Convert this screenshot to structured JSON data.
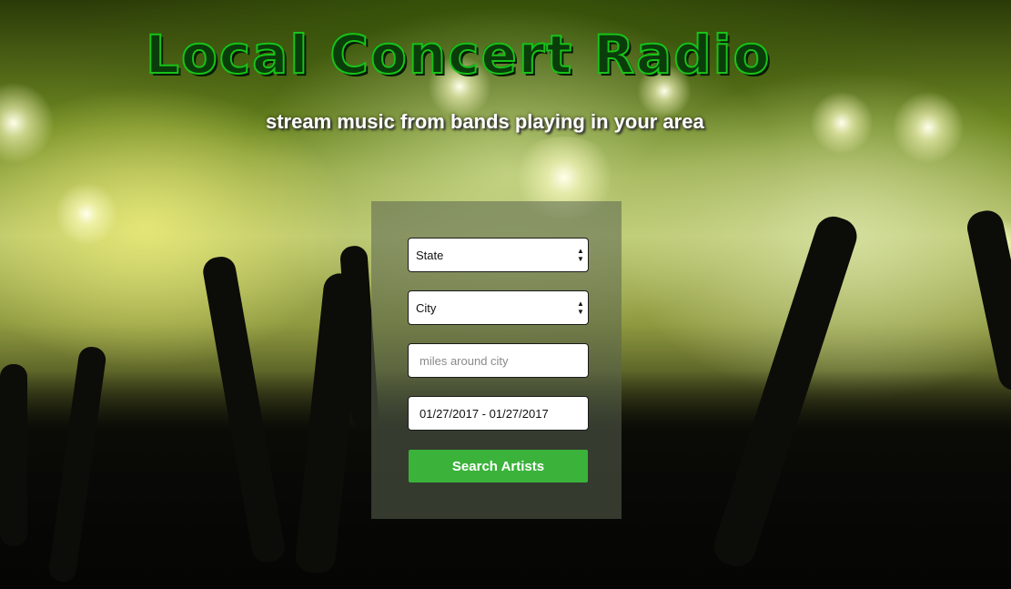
{
  "header": {
    "title": "Local Concert Radio",
    "subtitle": "stream music from bands playing in your area"
  },
  "form": {
    "state_select": {
      "value": "State"
    },
    "city_select": {
      "value": "City"
    },
    "miles_input": {
      "placeholder": "miles around city"
    },
    "date_range_input": {
      "value": "01/27/2017 - 01/27/2017"
    },
    "search_button": {
      "label": "Search Artists"
    }
  },
  "colors": {
    "title_green": "#19c219",
    "button_green": "#3bb33b"
  },
  "icons": {
    "select_caret": "up-down-chevron-icon"
  }
}
